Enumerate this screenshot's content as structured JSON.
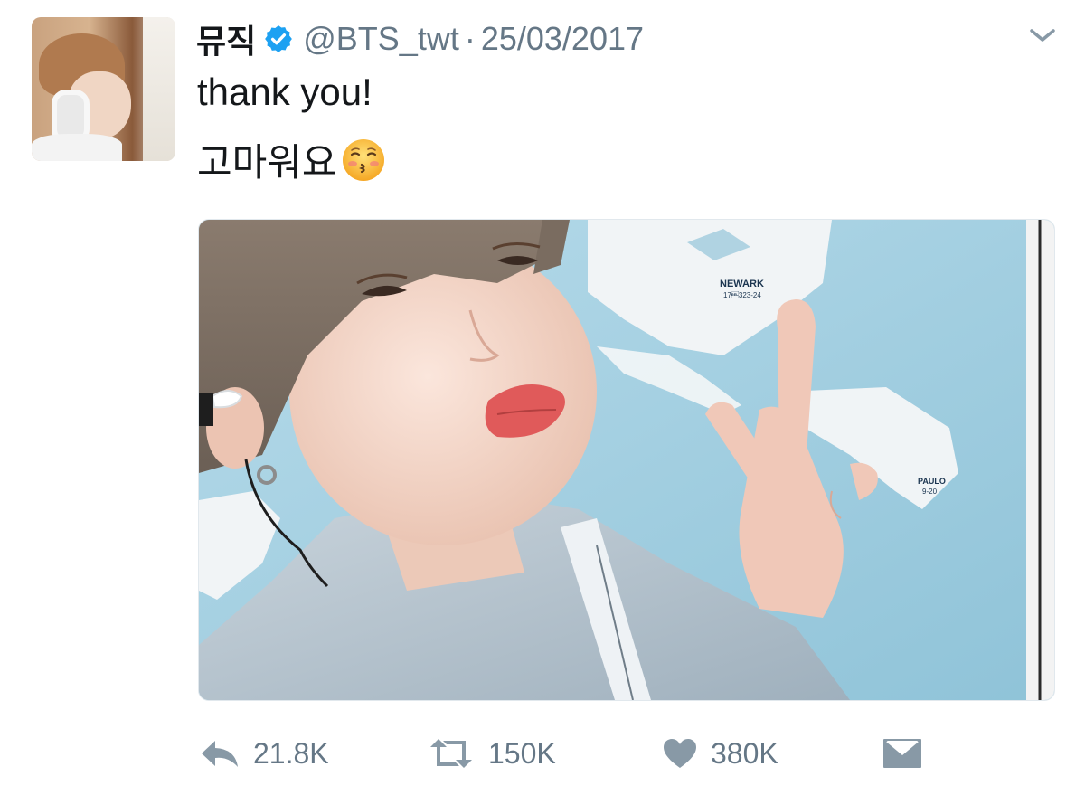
{
  "tweet": {
    "display_name": "뮤직",
    "handle": "@BTS_twt",
    "separator": "·",
    "date": "25/03/2017",
    "text_line1": "thank you!",
    "text_line2": "고마워요",
    "emoji": "kissing-face-emoji"
  },
  "photo": {
    "map_label_city": "NEWARK",
    "map_label_code": "17\u0007323-24",
    "map_label_city2": "PAULO",
    "map_label_code2": "9-20"
  },
  "actions": {
    "reply_count": "21.8K",
    "retweet_count": "150K",
    "like_count": "380K"
  },
  "icons": {
    "verified": "verified-badge-icon",
    "menu": "chevron-down-icon",
    "reply": "reply-icon",
    "retweet": "retweet-icon",
    "like": "heart-icon",
    "dm": "envelope-icon"
  },
  "colors": {
    "verified_blue": "#1da1f2",
    "muted_text": "#657786",
    "text": "#14171a"
  }
}
